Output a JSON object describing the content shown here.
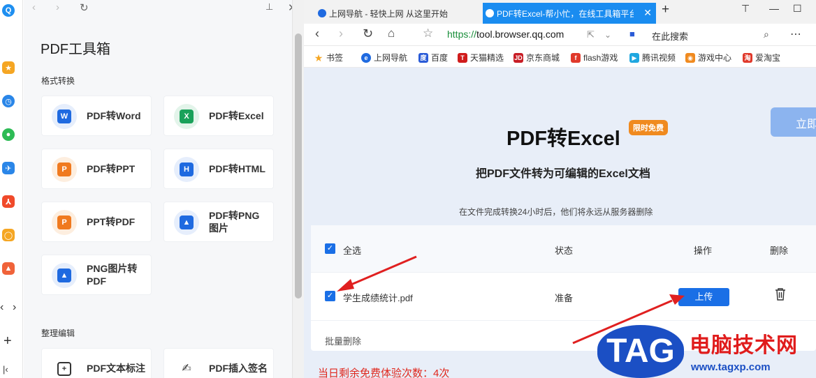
{
  "left_panel": {
    "title": "PDF工具箱",
    "section_convert": "格式转换",
    "tools": [
      {
        "label": "PDF转Word",
        "icon": "pdf-to-word-icon",
        "color": "#1f6ae0",
        "tag": "W"
      },
      {
        "label": "PDF转Excel",
        "icon": "pdf-to-excel-icon",
        "color": "#1aa15a",
        "tag": "X"
      },
      {
        "label": "PDF转PPT",
        "icon": "pdf-to-ppt-icon",
        "color": "#f07a1f",
        "tag": "P"
      },
      {
        "label": "PDF转HTML",
        "icon": "pdf-to-html-icon",
        "color": "#1f6ae0",
        "tag": "H"
      },
      {
        "label": "PPT转PDF",
        "icon": "ppt-to-pdf-icon",
        "color": "#f07a1f",
        "tag": "P"
      },
      {
        "label": "PDF转PNG图片",
        "icon": "pdf-to-png-icon",
        "color": "#1f6ae0",
        "tag": "▲"
      },
      {
        "label": "PNG图片转PDF",
        "icon": "png-to-pdf-icon",
        "color": "#1f6ae0",
        "tag": "▲"
      }
    ],
    "section_edit": "整理编辑",
    "edit_tools": [
      {
        "label": "PDF文本标注",
        "icon": "text-annotate-icon"
      },
      {
        "label": "PDF插入签名",
        "icon": "signature-icon"
      }
    ]
  },
  "browser": {
    "tabs": [
      {
        "label": "上网导航 - 轻快上网 从这里开始",
        "active": false
      },
      {
        "label": "PDF转Excel-帮小忙，在线工具箱平台",
        "active": true
      }
    ],
    "url_prefix": "https://",
    "url_rest": "tool.browser.qq.com",
    "search_placeholder": "在此搜索",
    "bookmarks": [
      {
        "label": "书签",
        "color": "#f5a623"
      },
      {
        "label": "上网导航",
        "color": "#1f6ae0"
      },
      {
        "label": "百度",
        "color": "#2a5bd7"
      },
      {
        "label": "天猫精选",
        "color": "#d01c1c"
      },
      {
        "label": "京东商城",
        "color": "#c81d25"
      },
      {
        "label": "flash游戏",
        "color": "#e0392b"
      },
      {
        "label": "腾讯视频",
        "color": "#1fa7e0"
      },
      {
        "label": "游戏中心",
        "color": "#f08a1f"
      },
      {
        "label": "爱淘宝",
        "color": "#e0392b"
      }
    ]
  },
  "page": {
    "title": "PDF转Excel",
    "badge": "限时免费",
    "subtitle": "把PDF文件转为可编辑的Excel文档",
    "note": "在文件完成转换24小时后，他们将永远从服务器删除",
    "try_button": "立即",
    "table": {
      "select_all": "全选",
      "col_status": "状态",
      "col_action": "操作",
      "col_delete": "删除",
      "row": {
        "filename": "学生成绩统计.pdf",
        "status": "准备",
        "upload": "上传"
      },
      "batch_delete": "批量删除"
    },
    "remaining": "当日剩余免费体验次数：4次"
  },
  "watermark": {
    "tag": "TAG",
    "title": "电脑技术网",
    "url": "www.tagxp.com"
  },
  "colors": {
    "accent": "#1a6fe6",
    "arrow": "#e02020",
    "content_bg": "#e8eef8"
  }
}
